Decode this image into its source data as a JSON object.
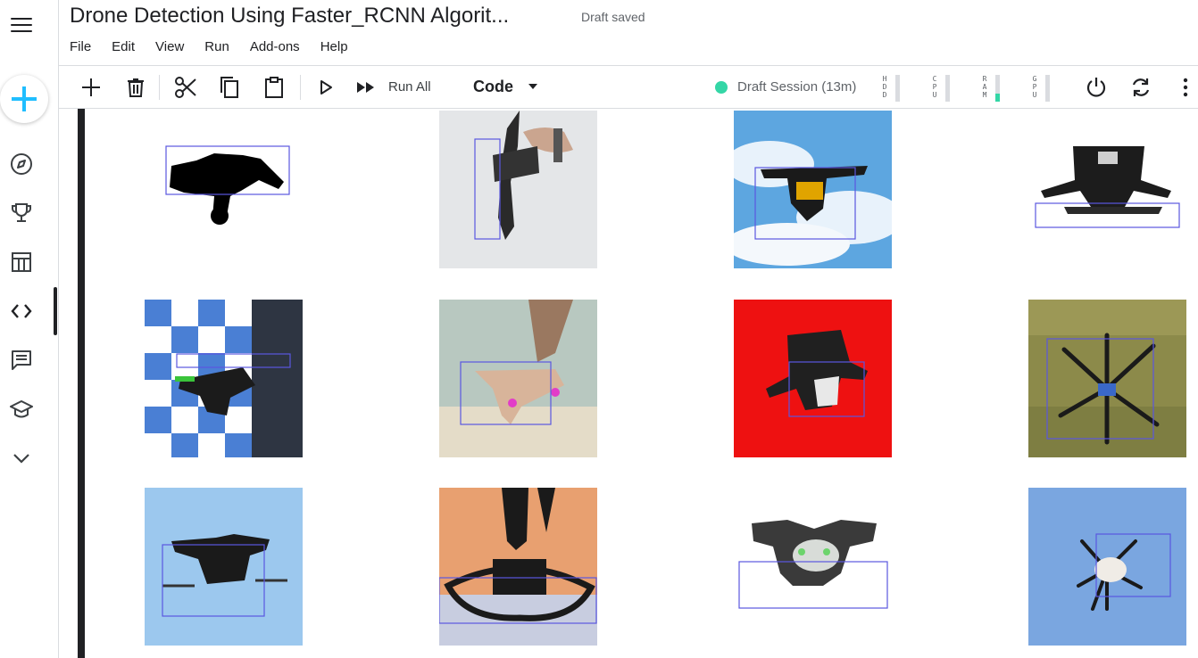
{
  "header": {
    "title": "Drone Detection Using Faster_RCNN Algorit...",
    "status": "Draft saved"
  },
  "menu": [
    "File",
    "Edit",
    "View",
    "Run",
    "Add-ons",
    "Help"
  ],
  "toolbar": {
    "run_all_label": "Run All",
    "cell_type": "Code",
    "session_label": "Draft Session (13m)",
    "meters": [
      {
        "letters": "H\nD\nD",
        "fill": 0.0
      },
      {
        "letters": "C\nP\nU",
        "fill": 0.0
      },
      {
        "letters": "R\nA\nM",
        "fill": 0.3
      },
      {
        "letters": "G\nP\nU",
        "fill": 0.0
      }
    ]
  },
  "rail": {
    "icons": [
      "menu-icon",
      "plus-icon",
      "compass-icon",
      "trophy-icon",
      "table-icon",
      "code-icon",
      "comment-icon",
      "school-icon",
      "chevron-down-icon"
    ]
  },
  "colors": {
    "accent": "#20beff",
    "session_green": "#34d6a6",
    "bbox": "#5a57e0"
  },
  "images": [
    {
      "name": "drone-silhouette",
      "bg": "#ffffff"
    },
    {
      "name": "drone-held-by-hand",
      "bg": "#e4e6e8"
    },
    {
      "name": "drone-sky-clouds",
      "bg": "#5da6e0"
    },
    {
      "name": "drone-white-bg",
      "bg": "#ffffff"
    },
    {
      "name": "drone-checkered-bg",
      "bg": "#4a7fd4"
    },
    {
      "name": "drone-beige-blur",
      "bg": "#b8c8c0"
    },
    {
      "name": "drone-red-bg",
      "bg": "#ee1111"
    },
    {
      "name": "drone-on-grass",
      "bg": "#8c8a4a"
    },
    {
      "name": "drone-light-blue-bg",
      "bg": "#9cc8ee"
    },
    {
      "name": "drone-orange-sunset",
      "bg": "#e8a070"
    },
    {
      "name": "drone-white-cutout",
      "bg": "#ffffff"
    },
    {
      "name": "drone-blue-sky",
      "bg": "#7aa6e0"
    }
  ]
}
